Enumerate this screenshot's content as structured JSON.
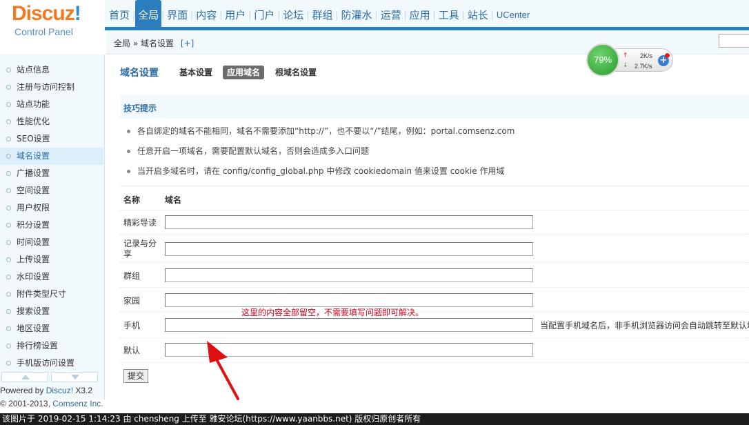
{
  "logo": {
    "brand": "Discuz",
    "brand_bang": "!",
    "subtitle": "Control Panel"
  },
  "topnav": [
    "首页",
    "全局",
    "界面",
    "内容",
    "用户",
    "门户",
    "论坛",
    "群组",
    "防灌水",
    "运营",
    "应用",
    "工具",
    "站长",
    "UCenter"
  ],
  "topnav_active": "全局",
  "breadcrumb": {
    "parent": "全局",
    "sep": "»",
    "current": "域名设置",
    "add": "[+]"
  },
  "sidebar": {
    "items": [
      "站点信息",
      "注册与访问控制",
      "站点功能",
      "性能优化",
      "SEO设置",
      "域名设置",
      "广播设置",
      "空间设置",
      "用户权限",
      "积分设置",
      "时间设置",
      "上传设置",
      "水印设置",
      "附件类型尺寸",
      "搜索设置",
      "地区设置",
      "排行榜设置",
      "手机版访问设置"
    ],
    "active": "域名设置"
  },
  "footer": {
    "powered_prefix": "Powered by ",
    "powered_link": "Discuz!",
    "powered_version": " X3.2",
    "copyright_prefix": "© 2001-2013, ",
    "copyright_link": "Comsenz Inc."
  },
  "main": {
    "title": "域名设置",
    "tabs": [
      {
        "label": "基本设置",
        "active": false
      },
      {
        "label": "应用域名",
        "active": true
      },
      {
        "label": "根域名设置",
        "active": false
      }
    ],
    "tips_title": "技巧提示",
    "tips": [
      "各自绑定的域名不能相同，域名不需要添加“http://”，也不要以“/”结尾，例如：portal.comsenz.com",
      "任意开启一项域名，需要配置默认域名，否则会造成多入口问题",
      "当开启多域名时，请在 config/config_global.php 中修改 cookiedomain 值来设置 cookie 作用域"
    ],
    "col_name": "名称",
    "col_domain": "域名",
    "rows": [
      {
        "label": "精彩导读",
        "value": "",
        "note": ""
      },
      {
        "label": "记录与分享",
        "value": "",
        "note": ""
      },
      {
        "label": "群组",
        "value": "",
        "note": ""
      },
      {
        "label": "家园",
        "value": "",
        "note": ""
      },
      {
        "label": "手机",
        "value": "",
        "note": "当配置手机域名后，非手机浏览器访问会自动跳转至默认域"
      },
      {
        "label": "默认",
        "value": "",
        "note": ""
      }
    ],
    "submit": "提交"
  },
  "annotation": "这里的内容全部留空，不需要填写问题即可解决。",
  "speed_widget": {
    "percent": "79%",
    "upload": "2K/s",
    "download": "2.7K/s",
    "plus": "+"
  },
  "watermark": "该图片于 2019-02-15 1:14:23 由 chensheng 上传至 雅安论坛(https://www.yaanbbs.net) 版权归原创者所有",
  "colors": {
    "accent": "#2b7dbc",
    "logo_orange": "#f07a22",
    "annotation": "#d0021b",
    "arrow": "#e01010"
  }
}
